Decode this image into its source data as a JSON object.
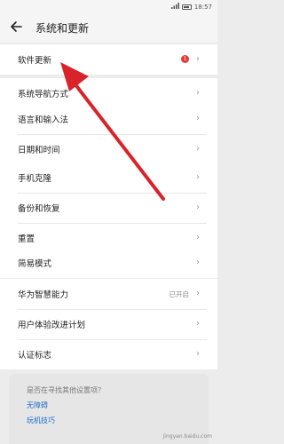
{
  "status_bar": {
    "time": "18:57"
  },
  "header": {
    "title": "系统和更新"
  },
  "groups": [
    {
      "items": [
        {
          "label": "软件更新",
          "badge": "1"
        }
      ]
    },
    {
      "items": [
        {
          "label": "系统导航方式"
        }
      ]
    },
    {
      "items": [
        {
          "label": "语言和输入法"
        },
        {
          "label": "日期和时间"
        }
      ]
    },
    {
      "items": [
        {
          "label": "手机克隆"
        },
        {
          "label": "备份和恢复"
        },
        {
          "label": "重置"
        }
      ]
    },
    {
      "items": [
        {
          "label": "简易模式"
        }
      ]
    },
    {
      "items": [
        {
          "label": "华为智慧能力",
          "status": "已开启"
        },
        {
          "label": "用户体验改进计划"
        },
        {
          "label": "认证标志"
        }
      ]
    }
  ],
  "suggestions": {
    "question": "是否在寻找其他设置项？",
    "links": [
      "无障碍",
      "玩机技巧"
    ]
  },
  "watermark": "jingyan.baidu.com",
  "annotation": {
    "arrow_color": "#d9232b"
  }
}
